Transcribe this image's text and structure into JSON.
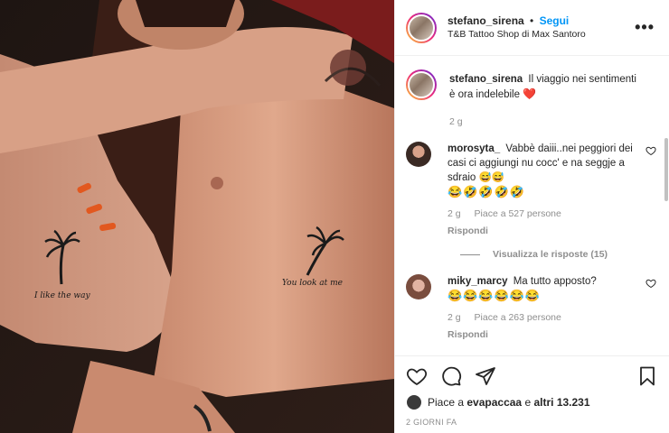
{
  "post": {
    "username": "stefano_sirena",
    "separator": "•",
    "follow_label": "Segui",
    "location": "T&B Tattoo Shop di Max Santoro",
    "more_icon": "more-dots-icon"
  },
  "image": {
    "tattoo_left_text": "I like the way",
    "tattoo_right_text": "You look at me"
  },
  "caption": {
    "username": "stefano_sirena",
    "text": "Il viaggio nei sentimenti è ora indelebile",
    "emoji": "❤️",
    "time": "2 g"
  },
  "comments": [
    {
      "username": "morosyta_",
      "text": "Vabbè daiii..nei peggiori dei casi ci aggiungi nu cocc' e na seggje a sdraio 😅😅",
      "emojis": "😂🤣🤣🤣🤣",
      "time": "2 g",
      "likes": "Piace a 527 persone",
      "reply": "Rispondi",
      "view_replies": "Visualizza le risposte (15)"
    },
    {
      "username": "miky_marcy",
      "text": "Ma tutto apposto?",
      "emojis": "😂😂😂😂😂😂",
      "time": "2 g",
      "likes": "Piace a 263 persone",
      "reply": "Rispondi"
    }
  ],
  "likes": {
    "prefix": "Piace a",
    "user": "evapaccaa",
    "middle": "e",
    "others": "altri 13.231"
  },
  "time_ago": "2 GIORNI FA",
  "colors": {
    "link_blue": "#0095f6",
    "secondary_text": "#8e8e8e",
    "heart_red": "#ed4956"
  }
}
